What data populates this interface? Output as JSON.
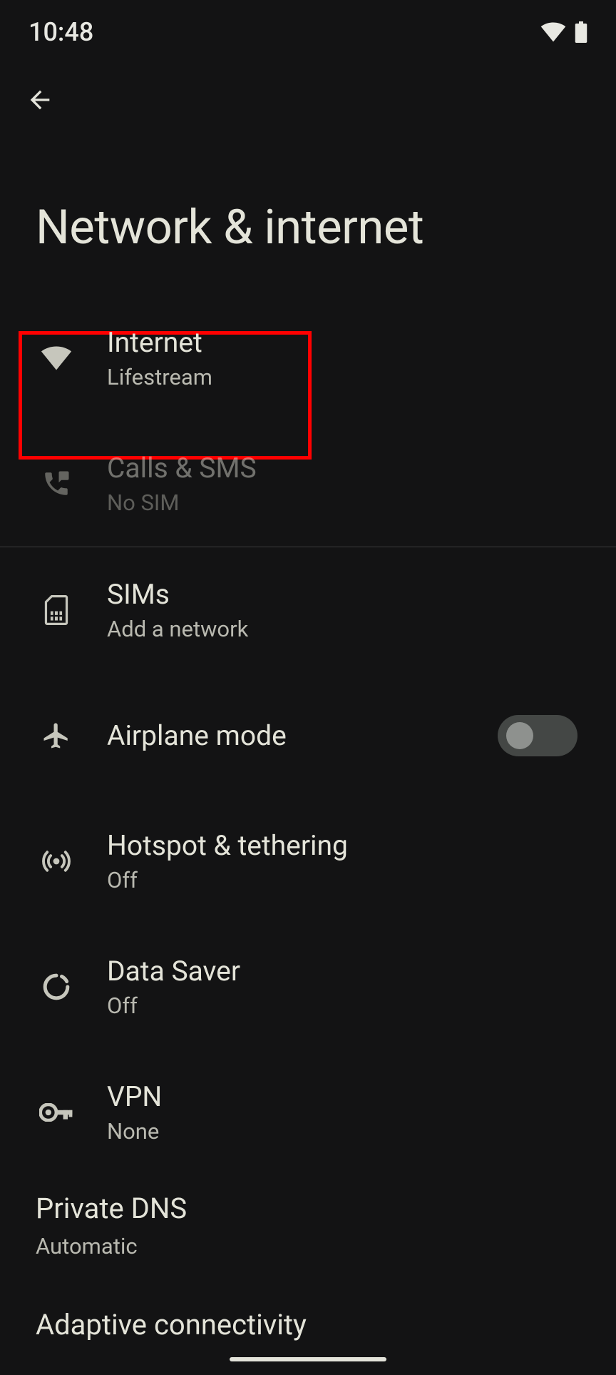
{
  "statusBar": {
    "time": "10:48"
  },
  "header": {
    "title": "Network & internet"
  },
  "items": {
    "internet": {
      "title": "Internet",
      "subtitle": "Lifestream"
    },
    "calls": {
      "title": "Calls & SMS",
      "subtitle": "No SIM"
    },
    "sims": {
      "title": "SIMs",
      "subtitle": "Add a network"
    },
    "airplane": {
      "title": "Airplane mode"
    },
    "hotspot": {
      "title": "Hotspot & tethering",
      "subtitle": "Off"
    },
    "datasaver": {
      "title": "Data Saver",
      "subtitle": "Off"
    },
    "vpn": {
      "title": "VPN",
      "subtitle": "None"
    },
    "privatedns": {
      "title": "Private DNS",
      "subtitle": "Automatic"
    },
    "adaptive": {
      "title": "Adaptive connectivity"
    }
  }
}
